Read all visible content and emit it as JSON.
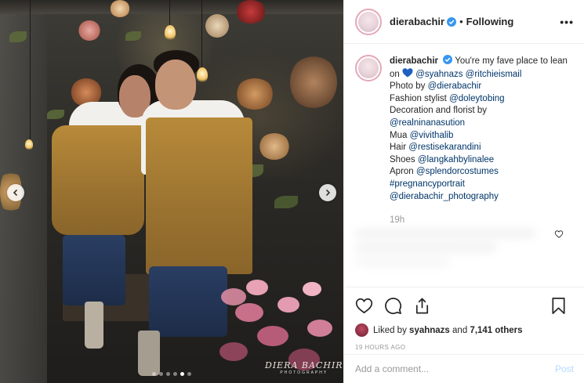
{
  "post": {
    "username": "dierabachir",
    "follow_separator": "•",
    "follow_status": "Following",
    "more_glyph": "•••",
    "image_watermark": {
      "main": "DIERA BACHIR",
      "sub": "PHOTOGRAPHY"
    },
    "carousel": {
      "count": 6,
      "active_index": 4
    }
  },
  "caption": {
    "username": "dierabachir",
    "text_before_emoji": "You're my fave place to lean on",
    "emoji": "blue-heart",
    "mention1": "@syahnazs",
    "mention2": "@ritchieismail",
    "lines": [
      {
        "label": "Photo by ",
        "link": "@dierabachir"
      },
      {
        "label": "Fashion stylist ",
        "link": "@doleytobing"
      },
      {
        "label": "Decoration and florist by ",
        "link": ""
      },
      {
        "label": "",
        "link": "@realninanasution"
      },
      {
        "label": "Mua ",
        "link": "@vivithalib"
      },
      {
        "label": "Hair ",
        "link": "@restisekarandini"
      },
      {
        "label": "Shoes ",
        "link": "@langkahbylinalee"
      },
      {
        "label": "Apron ",
        "link": "@splendorcostumes"
      },
      {
        "label": "",
        "link": "#pregnancyportrait"
      },
      {
        "label": "",
        "link": "@dierabachir_photography"
      }
    ],
    "time": "19h"
  },
  "actions": {
    "icons": [
      "heart-icon",
      "comment-icon",
      "share-icon",
      "bookmark-icon"
    ]
  },
  "likes": {
    "prefix": "Liked by ",
    "user": "syahnazs",
    "middle": " and ",
    "others": "7,141 others"
  },
  "timestamp": "19 HOURS AGO",
  "comment_box": {
    "placeholder": "Add a comment...",
    "post_label": "Post"
  },
  "colors": {
    "link": "#003569",
    "verified": "#3897f0",
    "post_disabled": "#b3dbff",
    "muted": "#999999"
  }
}
